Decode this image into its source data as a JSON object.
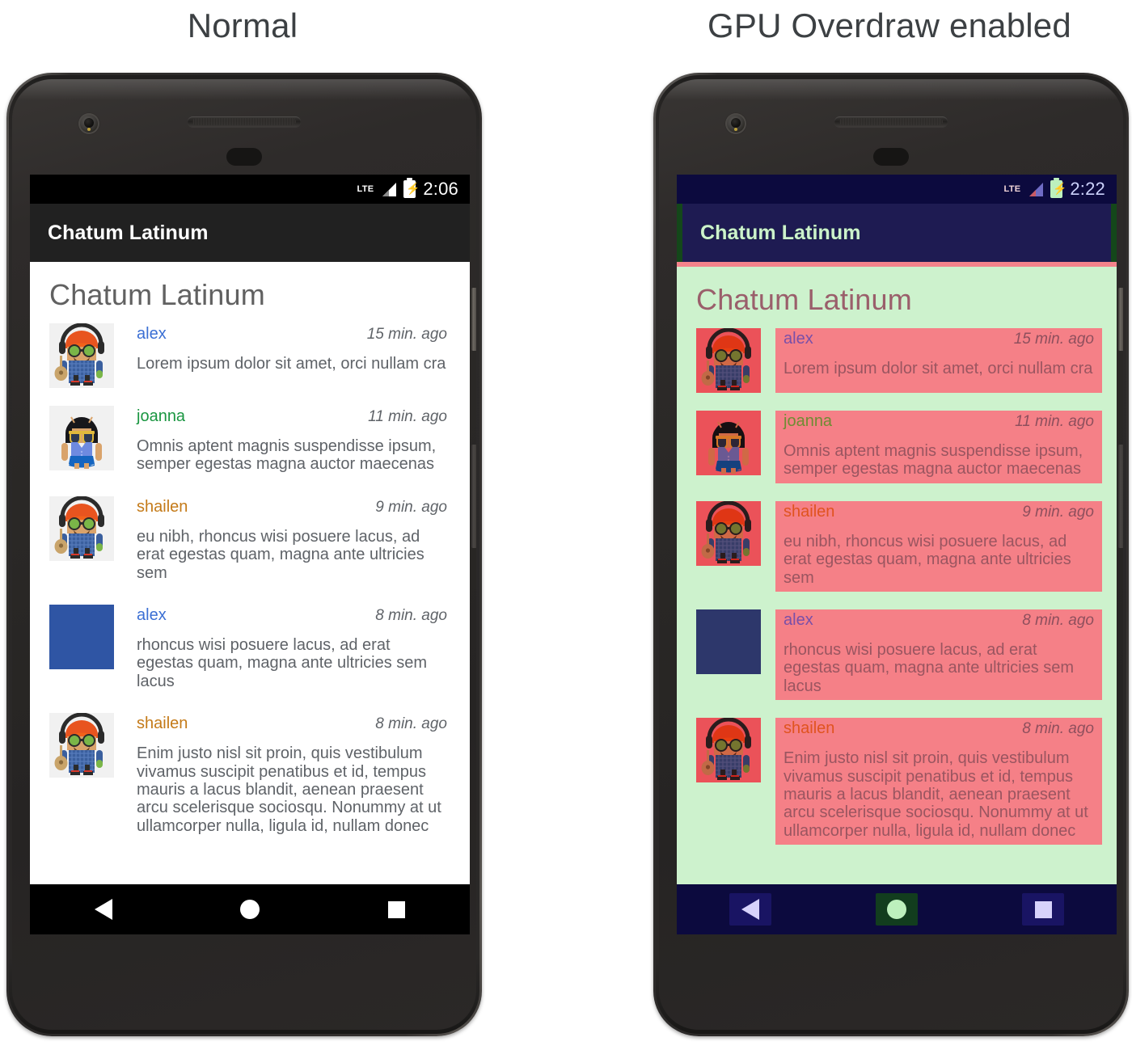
{
  "captions": {
    "left": "Normal",
    "right": "GPU Overdraw enabled"
  },
  "left_phone": {
    "status_bar": {
      "network": "LTE",
      "time": "2:06",
      "battery_icon": "battery-charging-icon",
      "signal_icon": "signal-bars-icon"
    },
    "app_bar": {
      "title": "Chatum Latinum"
    },
    "page_title": "Chatum Latinum",
    "nav_bar": {
      "back": "back-triangle-icon",
      "home": "home-circle-icon",
      "recents": "recents-square-icon"
    },
    "messages": [
      {
        "user": "alex",
        "user_color": "#3b6fd4",
        "time": "15 min. ago",
        "text": "Lorem ipsum dolor sit amet, orci nullam cra",
        "avatar": "hipster-bugdroid-avatar"
      },
      {
        "user": "joanna",
        "user_color": "#1a9641",
        "time": "11 min. ago",
        "text": "Omnis aptent magnis suspendisse ipsum, semper egestas magna auctor maecenas",
        "avatar": "sunglasses-bugdroid-avatar"
      },
      {
        "user": "shailen",
        "user_color": "#c47a18",
        "time": "9 min. ago",
        "text": "eu nibh, rhoncus wisi posuere lacus, ad erat egestas quam, magna ante ultricies sem",
        "avatar": "hipster-bugdroid-avatar"
      },
      {
        "user": "alex",
        "user_color": "#3b6fd4",
        "time": "8 min. ago",
        "text": "rhoncus wisi posuere lacus, ad erat egestas quam, magna ante ultricies sem lacus",
        "avatar": "blue-square-avatar"
      },
      {
        "user": "shailen",
        "user_color": "#c47a18",
        "time": "8 min. ago",
        "text": "Enim justo nisl sit proin, quis vestibulum vivamus suscipit penatibus et id, tempus mauris a lacus blandit, aenean praesent arcu scelerisque sociosqu. Nonummy at ut ullamcorper nulla, ligula id, nullam donec",
        "avatar": "hipster-bugdroid-avatar"
      }
    ]
  },
  "right_phone": {
    "status_bar": {
      "network": "LTE",
      "time": "2:22",
      "battery_icon": "battery-charging-icon",
      "signal_icon": "signal-bars-icon"
    },
    "app_bar": {
      "title": "Chatum Latinum"
    },
    "page_title": "Chatum Latinum",
    "nav_bar": {
      "back": "back-triangle-icon",
      "home": "home-circle-icon",
      "recents": "recents-square-icon"
    },
    "messages": [
      {
        "user": "alex",
        "user_color": "#7a4fa8",
        "time": "15 min. ago",
        "text": "Lorem ipsum dolor sit amet, orci nullam cra",
        "avatar": "hipster-bugdroid-avatar"
      },
      {
        "user": "joanna",
        "user_color": "#6f8c33",
        "time": "11 min. ago",
        "text": "Omnis aptent magnis suspendisse ipsum, semper egestas magna auctor maecenas",
        "avatar": "sunglasses-bugdroid-avatar"
      },
      {
        "user": "shailen",
        "user_color": "#e0531f",
        "time": "9 min. ago",
        "text": "eu nibh, rhoncus wisi posuere lacus, ad erat egestas quam, magna ante ultricies sem",
        "avatar": "hipster-bugdroid-avatar"
      },
      {
        "user": "alex",
        "user_color": "#7a4fa8",
        "time": "8 min. ago",
        "text": "rhoncus wisi posuere lacus, ad erat egestas quam, magna ante ultricies sem lacus",
        "avatar": "purple-square-avatar"
      },
      {
        "user": "shailen",
        "user_color": "#e0531f",
        "time": "8 min. ago",
        "text": "Enim justo nisl sit proin, quis vestibulum vivamus suscipit penatibus et id, tempus mauris a lacus blandit, aenean praesent arcu scelerisque sociosqu. Nonummy at ut ullamcorper nulla, ligula id, nullam donec",
        "avatar": "hipster-bugdroid-avatar"
      }
    ]
  },
  "colors": {
    "normal_statusbar": "#000000",
    "normal_appbar": "#212121",
    "normal_background": "#ffffff",
    "overdraw_1x_blue": "#0c0a3e",
    "overdraw_1x_green": "#cdf2cd",
    "overdraw_2x_green_dark": "#14471a",
    "overdraw_3x_pink": "#f58087",
    "overdraw_4x_red": "#e8262d",
    "phone_body": "#2b2928"
  }
}
